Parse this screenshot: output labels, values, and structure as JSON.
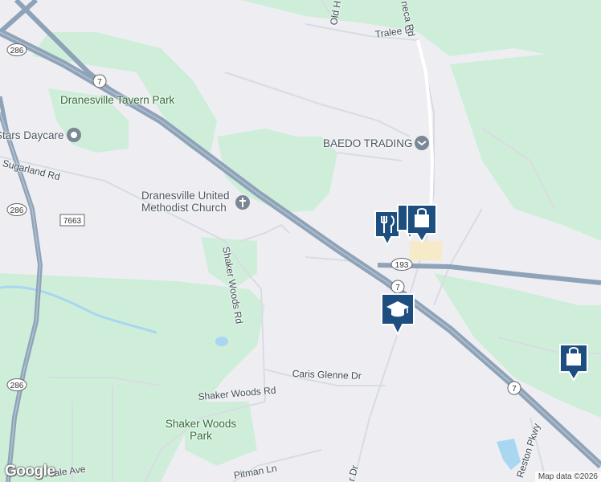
{
  "map": {
    "colors": {
      "land": "#eeeef2",
      "green": "#cfeed9",
      "highway": "#8fa3b8",
      "road": "#d7dce3",
      "water": "#a9d6f0",
      "pin": "#1d4e80"
    },
    "parks": [
      "Dranesville Tavern Park",
      "Shaker Woods Park"
    ],
    "places": [
      "Dranesville United Methodist Church",
      "BAEDO TRADING",
      "Stars Daycare"
    ],
    "streets": [
      "Sugarland Rd",
      "Shaker Woods Rd",
      "Shaker Woods Rd",
      "Caris Glenne Dr",
      "Tralee Dr",
      "Old H",
      "neca Rd",
      "Reston Pkwy",
      "Pitman Ln",
      "dale Ave",
      "r Dr"
    ],
    "route_shields": [
      "286",
      "7",
      "7663",
      "286",
      "193",
      "7",
      "286",
      "7"
    ],
    "attribution": "Map data ©2026",
    "logo": "Google"
  }
}
